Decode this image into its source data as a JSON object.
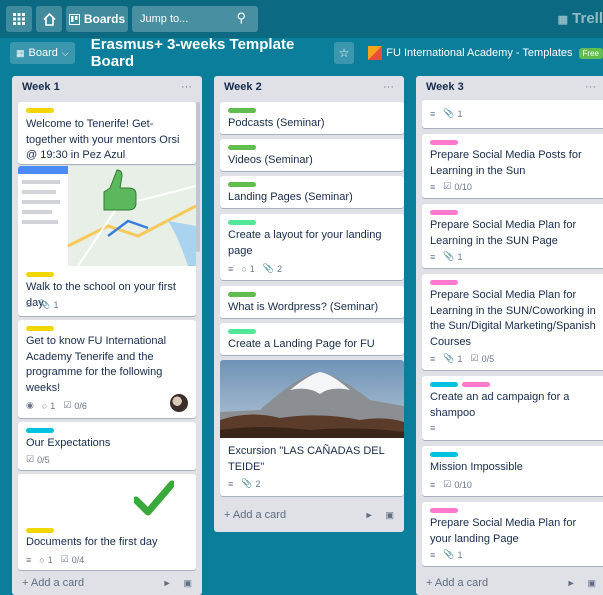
{
  "topbar": {
    "grid_icon": "grid-icon",
    "home_icon": "home-icon",
    "boards_label": "Boards",
    "search_placeholder": "Jump to...",
    "app_logo": "Trell"
  },
  "board": {
    "board_menu_label": "Board",
    "title": "Erasmus+ 3-weeks Template Board",
    "team_name": "FU International Academy - Templates",
    "team_plan": "Free"
  },
  "colors": {
    "board_bg": "#0a7e9a",
    "green": "#61bd4f",
    "yellow": "#f2d600",
    "pink": "#ff78cb",
    "blue": "#00c2e0",
    "lime": "#51e898"
  },
  "lists": [
    {
      "title": "Week 1",
      "add_card": "Add a card",
      "cards": [
        {
          "title": "Welcome to Tenerife! Get-together with your mentors Orsi @ 19:30 in Pez Azul",
          "labels": [
            "yellow"
          ]
        },
        {
          "title": "Walk to the school on your first day",
          "labels": [
            "yellow"
          ],
          "badges": {
            "attachments": "1"
          },
          "cover": "map"
        },
        {
          "title": "Get to know FU International Academy Tenerife and the programme for the following weeks!",
          "labels": [
            "yellow"
          ],
          "badges": {
            "comments": "1",
            "checklist": "0/6"
          }
        },
        {
          "title": "Our Expectations",
          "labels": [
            "blue"
          ],
          "badges": {
            "checklist": "0/5"
          }
        },
        {
          "title": "Documents for the first day",
          "labels": [
            "yellow"
          ],
          "badges": {
            "comments": "1",
            "checklist": "0/4"
          },
          "sticker": "checkmark"
        }
      ]
    },
    {
      "title": "Week 2",
      "add_card": "Add a card",
      "cards": [
        {
          "title": "Podcasts (Seminar)",
          "labels": [
            "green"
          ]
        },
        {
          "title": "Videos (Seminar)",
          "labels": [
            "green"
          ]
        },
        {
          "title": "Landing Pages (Seminar)",
          "labels": [
            "green"
          ]
        },
        {
          "title": "Create a layout for your landing page",
          "labels": [
            "lime"
          ],
          "badges": {
            "comments": "1",
            "attachments": "2"
          }
        },
        {
          "title": "What is Wordpress? (Seminar)",
          "labels": [
            "green"
          ]
        },
        {
          "title": "Create a Landing Page for FU Café",
          "labels": [
            "lime"
          ]
        },
        {
          "title": "Excursion \"LAS CAÑADAS DEL TEIDE\"",
          "badges": {
            "attachments": "2"
          },
          "cover": "mountain"
        }
      ]
    },
    {
      "title": "Week 3",
      "add_card": "Add a card",
      "cards": [
        {
          "title": "",
          "badges": {
            "attachments": "1"
          }
        },
        {
          "title": "Prepare Social Media Posts for Learning in the Sun",
          "labels": [
            "pink"
          ],
          "badges": {
            "checklist": "0/10"
          }
        },
        {
          "title": "Prepare Social Media Plan for Learning in the SUN Page",
          "labels": [
            "pink"
          ],
          "badges": {
            "attachments": "1"
          }
        },
        {
          "title": "Prepare Social Media Plan for Learning in the SUN/Coworking in the Sun/Digital Marketing/Spanish Courses",
          "labels": [
            "pink"
          ],
          "badges": {
            "attachments": "1",
            "checklist": "0/5"
          }
        },
        {
          "title": "Create an ad campaign for a shampoo",
          "labels": [
            "blue",
            "pink"
          ]
        },
        {
          "title": "Mission Impossible",
          "labels": [
            "blue"
          ],
          "badges": {
            "checklist": "0/10"
          }
        },
        {
          "title": "Prepare Social Media Plan for your landing Page",
          "labels": [
            "pink"
          ],
          "badges": {
            "attachments": "1"
          }
        }
      ]
    }
  ]
}
